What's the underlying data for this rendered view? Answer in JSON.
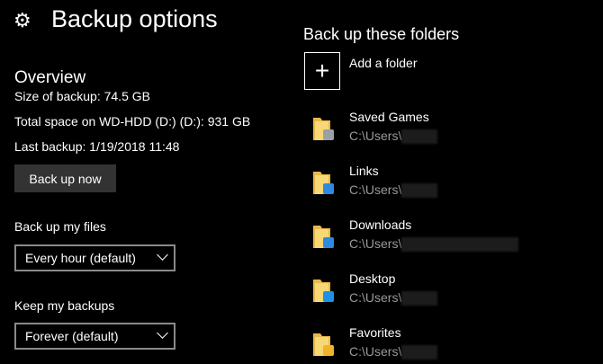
{
  "header": {
    "title": "Backup options",
    "icon": "gear-icon"
  },
  "overview": {
    "heading": "Overview",
    "size": "Size of backup: 74.5 GB",
    "total_space": "Total space on WD-HDD (D:) (D:): 931 GB",
    "last_backup": "Last backup: 1/19/2018 11:48",
    "backup_now_label": "Back up now"
  },
  "frequency": {
    "label": "Back up my files",
    "value": "Every hour (default)"
  },
  "retention": {
    "label": "Keep my backups",
    "value": "Forever (default)"
  },
  "folders": {
    "heading": "Back up these folders",
    "add_label": "Add a folder",
    "items": [
      {
        "name": "Saved Games",
        "path": "C:\\Users\\",
        "badge": "#9aa0a8"
      },
      {
        "name": "Links",
        "path": "C:\\Users\\",
        "badge": "#2d8ae0"
      },
      {
        "name": "Downloads",
        "path": "C:\\Users\\",
        "badge": "#2d8ae0"
      },
      {
        "name": "Desktop",
        "path": "C:\\Users\\",
        "badge": "#1e90e8"
      },
      {
        "name": "Favorites",
        "path": "C:\\Users\\",
        "badge": "#f0b429"
      }
    ]
  }
}
